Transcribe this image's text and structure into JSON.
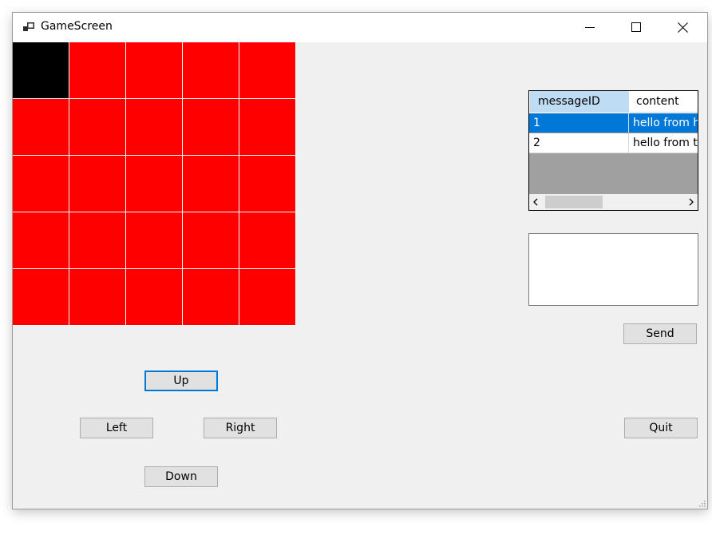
{
  "window": {
    "title": "GameScreen",
    "icon": "app-window-icon",
    "controls": [
      "minimize-icon",
      "maximize-icon",
      "close-icon"
    ]
  },
  "board": {
    "rows": 5,
    "cols": 5,
    "player_cell": [
      0,
      0
    ],
    "colors": {
      "empty": "#ff0000",
      "player": "#000000"
    }
  },
  "controls": {
    "up": "Up",
    "left": "Left",
    "right": "Right",
    "down": "Down",
    "send": "Send",
    "quit": "Quit"
  },
  "messages": {
    "columns": [
      "messageID",
      "content"
    ],
    "rows": [
      {
        "id": "1",
        "content": "hello from h",
        "selected": true
      },
      {
        "id": "2",
        "content": "hello from th",
        "selected": false
      }
    ]
  },
  "message_input": {
    "value": ""
  },
  "accent": "#0078d7"
}
